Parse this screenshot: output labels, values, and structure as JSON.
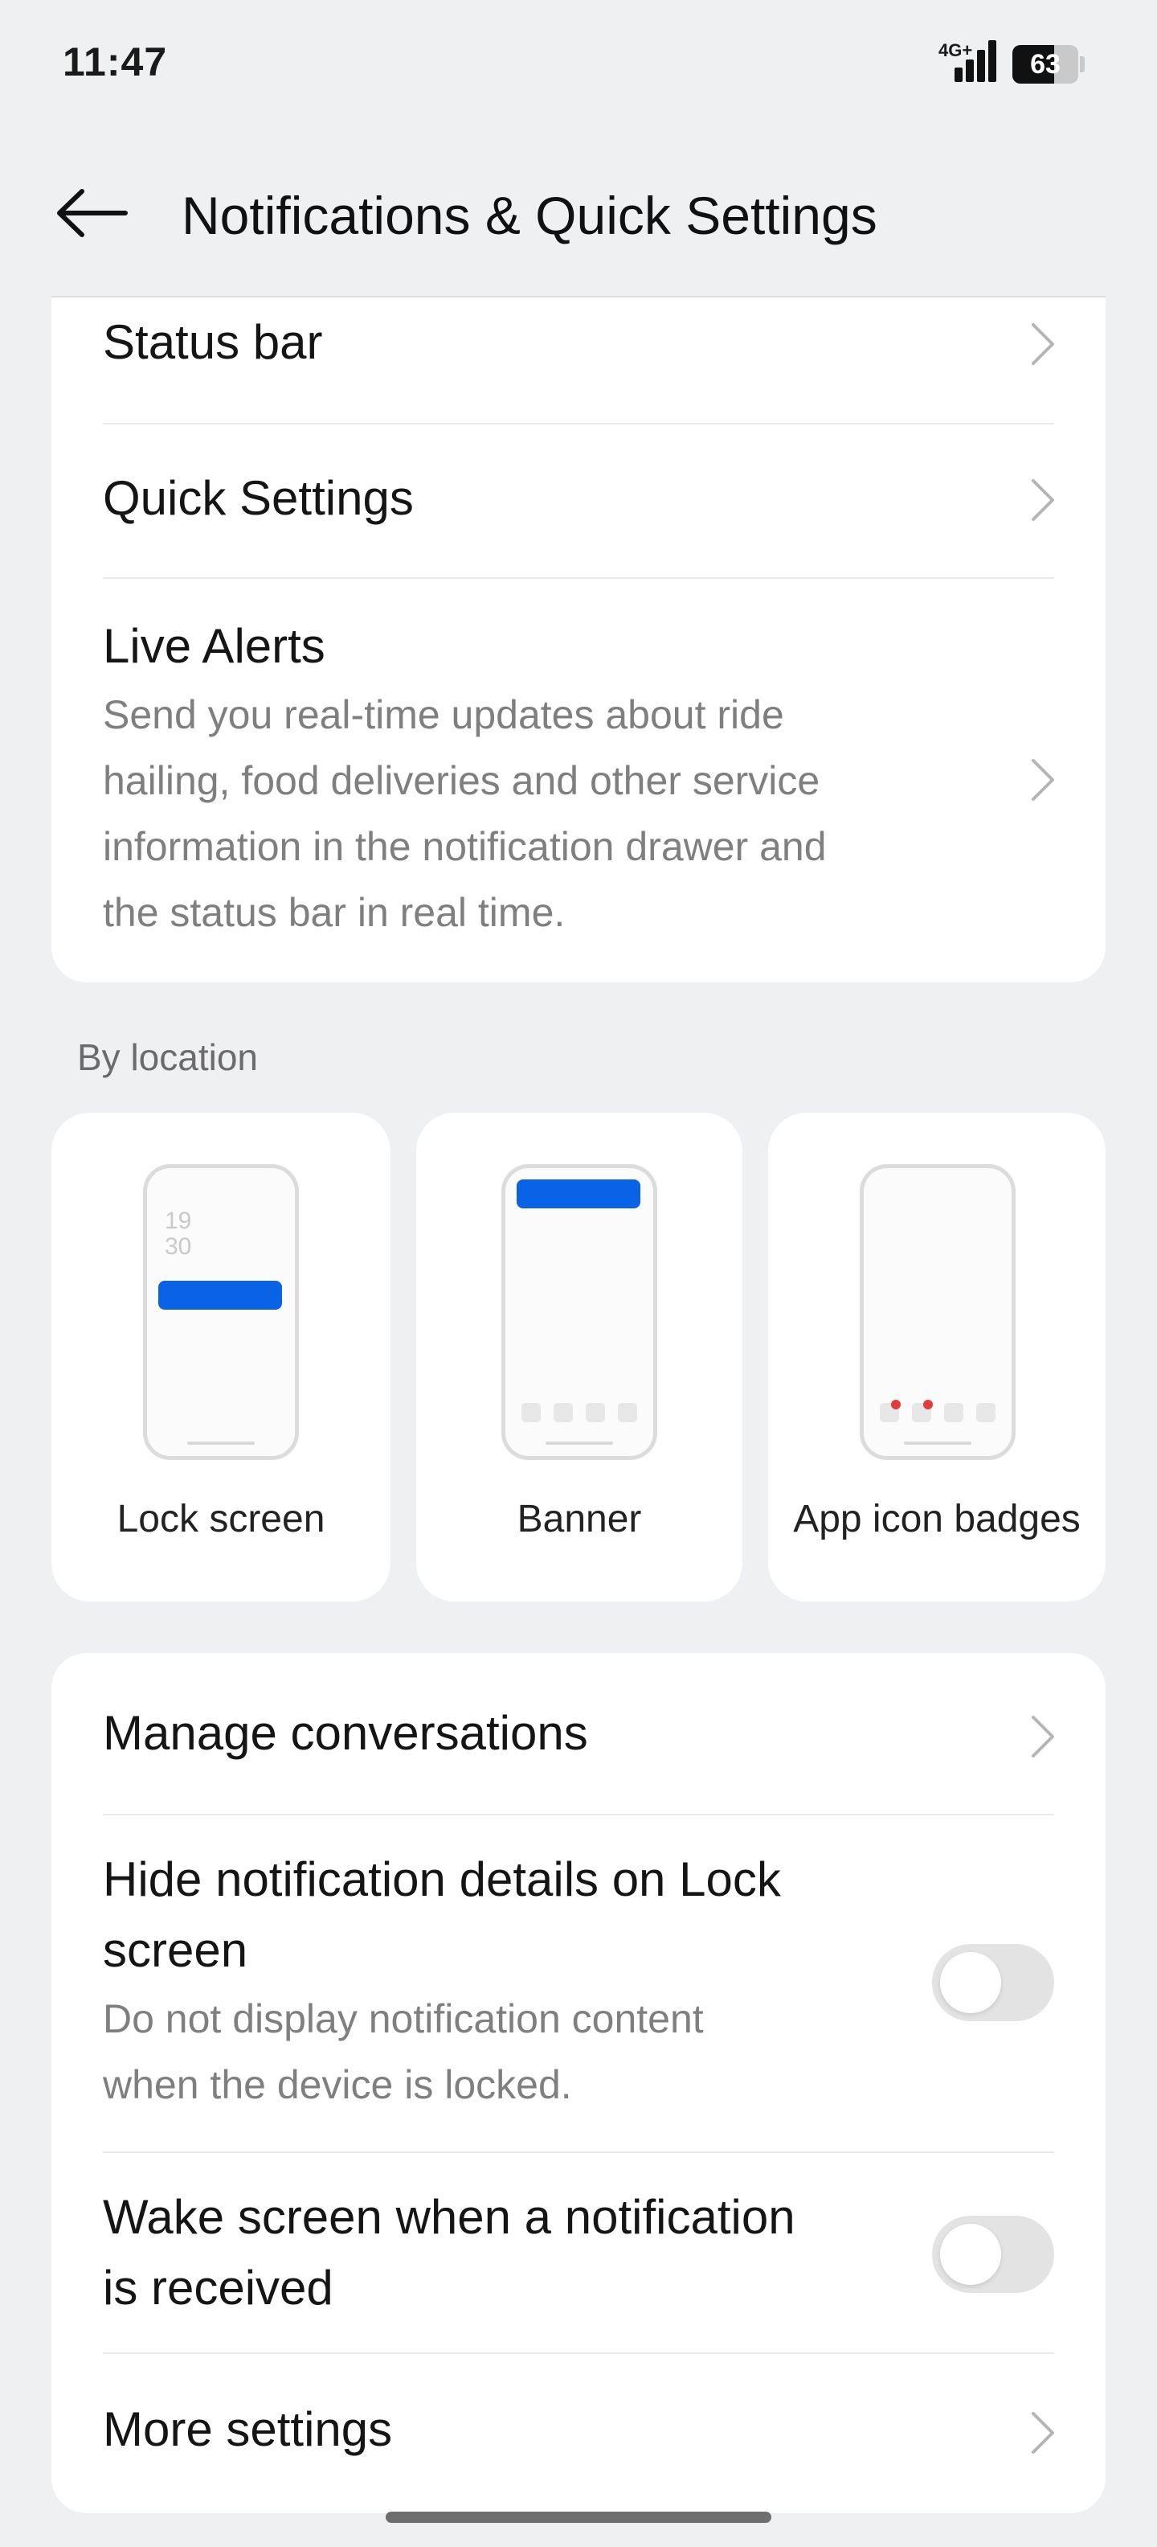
{
  "status_bar": {
    "time": "11:47",
    "network": "4G+",
    "battery_percent": "63",
    "battery_level": 0.63
  },
  "header": {
    "title": "Notifications & Quick Settings",
    "back_icon": "arrow-left-icon"
  },
  "settings_group_1": {
    "items": [
      {
        "title": "Status bar"
      },
      {
        "title": "Quick Settings"
      },
      {
        "title": "Live Alerts",
        "subtitle_lines": [
          "Send you real-time updates about ride",
          "hailing, food deliveries and other service",
          "information in the notification drawer and",
          "the status bar in real time."
        ]
      }
    ]
  },
  "by_location": {
    "label": "By location",
    "cards": [
      {
        "label": "Lock screen",
        "clock": [
          "19",
          "30"
        ]
      },
      {
        "label": "Banner"
      },
      {
        "label": "App icon badges"
      }
    ]
  },
  "settings_group_2": {
    "manage_conversations": "Manage conversations",
    "hide_details": {
      "title_lines": [
        "Hide notification details on Lock",
        "screen"
      ],
      "subtitle_lines": [
        "Do not display notification content",
        "when the device is locked."
      ],
      "enabled": false
    },
    "wake_screen": {
      "title_lines": [
        "Wake screen when a notification",
        "is received"
      ],
      "enabled": false
    },
    "more_settings": "More settings"
  },
  "colors": {
    "background": "#eff0f2",
    "card": "#ffffff",
    "accent_blue": "#0a62e6",
    "badge_red": "#e63b3b",
    "toggle_off": "#e3e3e3"
  }
}
